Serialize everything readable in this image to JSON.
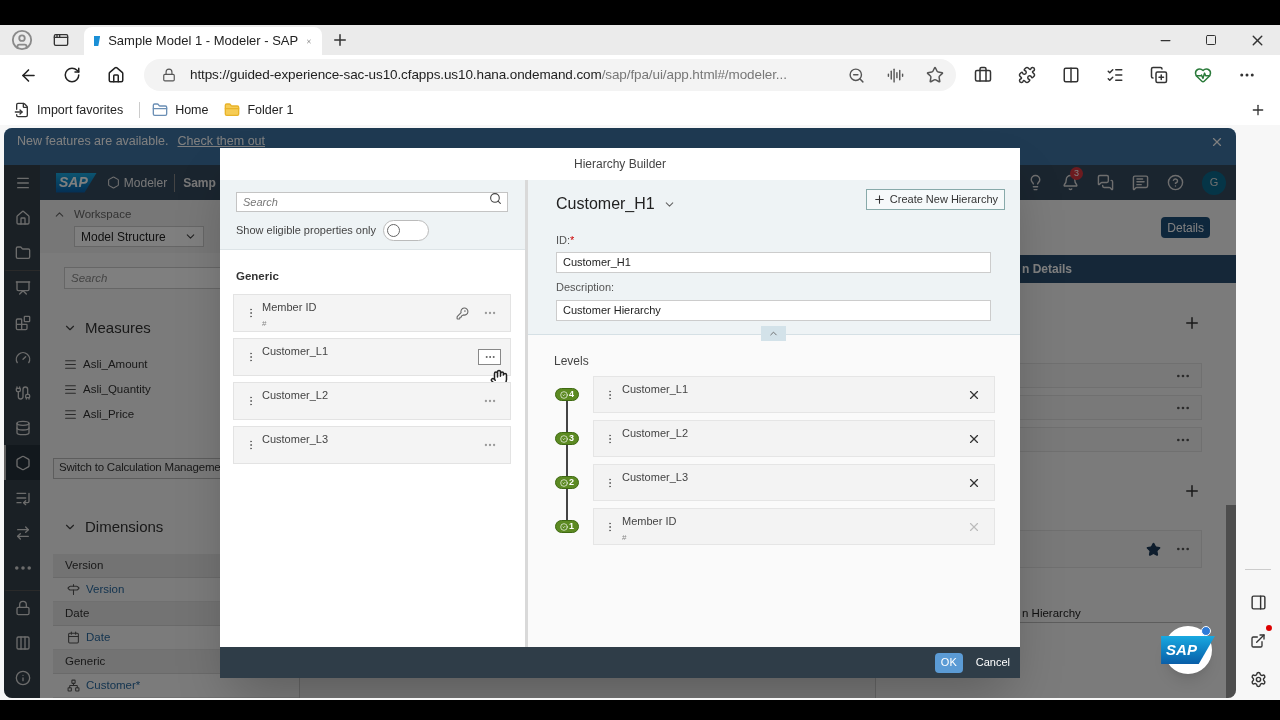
{
  "browser": {
    "tab_title": "Sample Model 1 - Modeler - SAP",
    "url_host": "https://guided-experience-sac-us10.cfapps.us10.hana.ondemand.com",
    "url_path": "/sap/fpa/ui/app.html#/modeler...",
    "bookmarks": [
      "Import favorites",
      "Home",
      "Folder 1"
    ]
  },
  "notification": {
    "text": "New features are available.",
    "link": "Check them out"
  },
  "shell": {
    "logo": "SAP",
    "app": "Modeler",
    "title": "Samp",
    "notification_count": "3",
    "avatar": "G"
  },
  "nav": [
    {
      "selected": false
    },
    {
      "selected": false
    },
    {
      "selected": false
    },
    {
      "selected": false
    },
    {
      "selected": false
    },
    {
      "selected": false
    },
    {
      "selected": false
    },
    {
      "selected": false
    },
    {
      "selected": true
    },
    {
      "selected": false
    },
    {
      "selected": false
    },
    {
      "selected": false
    },
    {
      "selected": false
    },
    {
      "selected": false
    },
    {
      "selected": false
    }
  ],
  "workspace": {
    "label": "Workspace",
    "value": "Model Structure",
    "search_placeholder": "Search"
  },
  "measures": {
    "title": "Measures",
    "expanded": true,
    "items": [
      "Asli_Amount",
      "Asli_Quantity",
      "Asli_Price"
    ]
  },
  "switch_button": "Switch to Calculation Manageme",
  "dimensions": {
    "title": "Dimensions",
    "expanded": true,
    "groups": [
      {
        "heading": "Version",
        "kind": "version",
        "items": [
          "Version"
        ]
      },
      {
        "heading": "Date",
        "kind": "date",
        "items": [
          "Date"
        ]
      },
      {
        "heading": "Generic",
        "kind": "generic",
        "items": [
          "Customer*"
        ]
      }
    ]
  },
  "details_panel": {
    "button": "Details",
    "tab": "n Details",
    "rows": [
      {
        "starred": false
      },
      {
        "starred": false
      },
      {
        "starred": false
      }
    ],
    "rows_2": [
      {
        "starred": true
      }
    ],
    "field": "n Hierarchy"
  },
  "sap_button": {
    "logo": "SAP",
    "has_notification": true
  },
  "dialog": {
    "title": "Hierarchy Builder",
    "search_placeholder": "Search",
    "eligible_label": "Show eligible properties only",
    "eligible_only": false,
    "group": "Generic",
    "properties": [
      {
        "name": "Member ID",
        "subtitle": "#",
        "key": true,
        "hovered": false
      },
      {
        "name": "Customer_L1",
        "key": false,
        "hovered": true
      },
      {
        "name": "Customer_L2",
        "key": false,
        "hovered": false
      },
      {
        "name": "Customer_L3",
        "key": false,
        "hovered": false
      }
    ],
    "hierarchy": "Customer_H1",
    "create_button": "Create New Hierarchy",
    "id_label": "ID:",
    "required_mark": "*",
    "id_value": "Customer_H1",
    "description_label": "Description:",
    "description_value": "Customer Hierarchy",
    "levels_title": "Levels",
    "levels": [
      {
        "number": "4",
        "name": "Customer_L1",
        "remove_disabled": false
      },
      {
        "number": "3",
        "name": "Customer_L2",
        "remove_disabled": false
      },
      {
        "number": "2",
        "name": "Customer_L3",
        "remove_disabled": false
      },
      {
        "number": "1",
        "name": "Member ID",
        "subtitle": "#",
        "remove_disabled": true
      }
    ],
    "ok": "OK",
    "cancel": "Cancel"
  }
}
